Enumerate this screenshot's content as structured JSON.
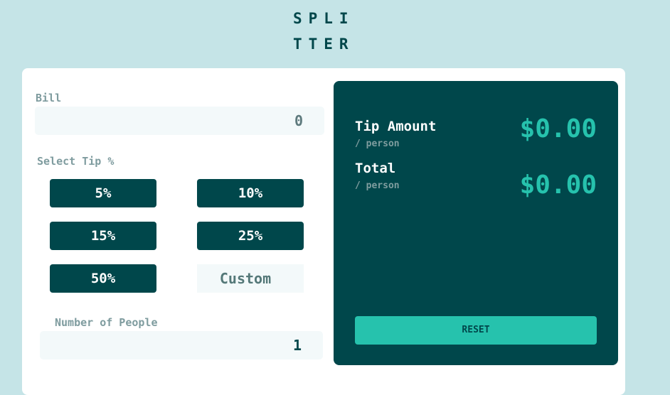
{
  "logo": {
    "line1": "SPLI",
    "line2": "TTER"
  },
  "bill": {
    "label": "Bill",
    "value": "0"
  },
  "tip": {
    "label": "Select Tip %",
    "options": [
      "5%",
      "10%",
      "15%",
      "25%",
      "50%"
    ],
    "custom_placeholder": "Custom"
  },
  "people": {
    "label": "Number of People",
    "value": "1"
  },
  "results": {
    "tip_amount_label": "Tip Amount",
    "tip_amount_sub": "/ person",
    "tip_amount_value": "$0.00",
    "total_label": "Total",
    "total_sub": "/ person",
    "total_value": "$0.00",
    "reset_label": "RESET"
  },
  "colors": {
    "background": "#c5e4e7",
    "dark_cyan": "#00474b",
    "strong_cyan": "#26c2ad",
    "input_bg": "#f3f9fa"
  }
}
